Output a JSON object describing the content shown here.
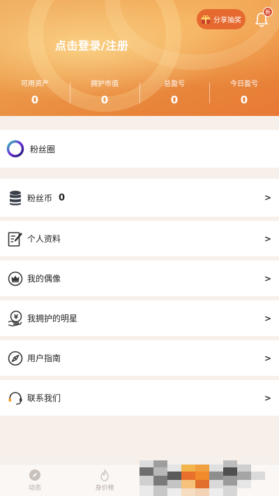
{
  "header": {
    "share_label": "分享抽奖",
    "badge": "新",
    "login_text": "点击登录/注册",
    "stats": [
      {
        "label": "可用资产",
        "value": "0"
      },
      {
        "label": "拥护市值",
        "value": "0"
      },
      {
        "label": "总盈亏",
        "value": "0"
      },
      {
        "label": "今日盈亏",
        "value": "0"
      }
    ]
  },
  "menu": {
    "fans_circle": "粉丝圈",
    "fans_coin": "粉丝币",
    "fans_coin_count": "0",
    "profile": "个人资料",
    "my_idol": "我的偶像",
    "my_stars": "我拥护的明星",
    "guide": "用户指南",
    "contact": "联系我们",
    "arrow": ">"
  },
  "tabbar": {
    "tabs": [
      {
        "label": "动态",
        "icon": "compass-icon"
      },
      {
        "label": "身价榜",
        "icon": "flame-icon"
      }
    ]
  },
  "colors": {
    "accent": "#e66a2f",
    "header_orange": "#ec9a4a",
    "background": "#f7efea"
  }
}
